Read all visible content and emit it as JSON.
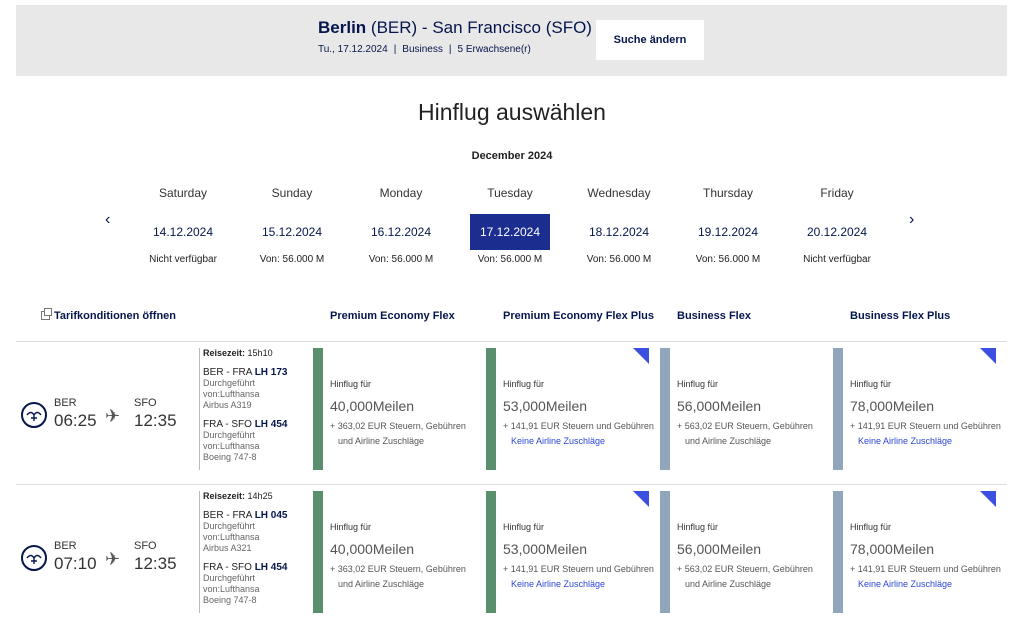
{
  "header": {
    "route_origin": "Berlin",
    "route_origin_code": "(BER)",
    "route_dash": " - ",
    "route_dest": "San Francisco (SFO)",
    "date": "Tu., 17.12.2024",
    "cabin": "Business",
    "passengers": "5 Erwachsene(r)",
    "separator": "|",
    "change_button": "Suche ändern"
  },
  "title": "Hinflug auswählen",
  "month": "December 2024",
  "nav": {
    "prev": "‹",
    "next": "›"
  },
  "days": [
    {
      "weekday": "Saturday",
      "date": "14.12.2024",
      "price": "Nicht verfügbar"
    },
    {
      "weekday": "Sunday",
      "date": "15.12.2024",
      "price": "Von: 56.000 M"
    },
    {
      "weekday": "Monday",
      "date": "16.12.2024",
      "price": "Von: 56.000 M"
    },
    {
      "weekday": "Tuesday",
      "date": "17.12.2024",
      "price": "Von: 56.000 M",
      "selected": true
    },
    {
      "weekday": "Wednesday",
      "date": "18.12.2024",
      "price": "Von: 56.000 M"
    },
    {
      "weekday": "Thursday",
      "date": "19.12.2024",
      "price": "Von: 56.000 M"
    },
    {
      "weekday": "Friday",
      "date": "20.12.2024",
      "price": "Nicht verfügbar"
    }
  ],
  "fare_header": {
    "open_conditions": "Tarifkonditionen öffnen",
    "columns": [
      "Premium Economy Flex",
      "Premium Economy Flex Plus",
      "Business Flex",
      "Business Flex Plus"
    ]
  },
  "flights": [
    {
      "dep_code": "BER",
      "dep_time": "06:25",
      "arr_code": "SFO",
      "arr_time": "12:35",
      "duration_label": "Reisezeit:",
      "duration": "15h10",
      "segments": [
        {
          "route": "BER - FRA",
          "flight": "LH 173",
          "op1": "Durchgeführt",
          "op2": "von:Lufthansa",
          "aircraft": "Airbus A319"
        },
        {
          "route": "FRA - SFO",
          "flight": "LH 454",
          "op1": "Durchgeführt",
          "op2": "von:Lufthansa",
          "aircraft": "Boeing 747-8"
        }
      ],
      "fares": [
        {
          "label": "Hinflug für",
          "miles": "40,000Meilen",
          "tax": "+ 363,02 EUR Steuern, Gebühren",
          "tax2": "und Airline Zuschläge",
          "link": "",
          "corner": false
        },
        {
          "label": "Hinflug für",
          "miles": "53,000Meilen",
          "tax": "+ 141,91 EUR Steuern und Gebühren",
          "tax2": "",
          "link": "Keine Airline Zuschläge",
          "corner": true
        },
        {
          "label": "Hinflug für",
          "miles": "56,000Meilen",
          "tax": "+ 563,02 EUR Steuern, Gebühren",
          "tax2": "und Airline Zuschläge",
          "link": "",
          "corner": false
        },
        {
          "label": "Hinflug für",
          "miles": "78,000Meilen",
          "tax": "+ 141,91 EUR Steuern und Gebühren",
          "tax2": "",
          "link": "Keine Airline Zuschläge",
          "corner": true
        }
      ]
    },
    {
      "dep_code": "BER",
      "dep_time": "07:10",
      "arr_code": "SFO",
      "arr_time": "12:35",
      "duration_label": "Reisezeit:",
      "duration": "14h25",
      "segments": [
        {
          "route": "BER - FRA",
          "flight": "LH 045",
          "op1": "Durchgeführt",
          "op2": "von:Lufthansa",
          "aircraft": "Airbus A321"
        },
        {
          "route": "FRA - SFO",
          "flight": "LH 454",
          "op1": "Durchgeführt",
          "op2": "von:Lufthansa",
          "aircraft": "Boeing 747-8"
        }
      ],
      "fares": [
        {
          "label": "Hinflug für",
          "miles": "40,000Meilen",
          "tax": "+ 363,02 EUR Steuern, Gebühren",
          "tax2": "und Airline Zuschläge",
          "link": "",
          "corner": false
        },
        {
          "label": "Hinflug für",
          "miles": "53,000Meilen",
          "tax": "+ 141,91 EUR Steuern und Gebühren",
          "tax2": "",
          "link": "Keine Airline Zuschläge",
          "corner": true
        },
        {
          "label": "Hinflug für",
          "miles": "56,000Meilen",
          "tax": "+ 563,02 EUR Steuern, Gebühren",
          "tax2": "und Airline Zuschläge",
          "link": "",
          "corner": false
        },
        {
          "label": "Hinflug für",
          "miles": "78,000Meilen",
          "tax": "+ 141,91 EUR Steuern und Gebühren",
          "tax2": "",
          "link": "Keine Airline Zuschläge",
          "corner": true
        }
      ]
    }
  ],
  "icons": {
    "airline_logo": "crane-logo-icon",
    "plane": "plane-icon",
    "corner": "corner-flag-icon",
    "open": "external-window-icon"
  },
  "colors": {
    "navy": "#05164d",
    "selected_date": "#1b2d8f",
    "premium_bar": "#5a8f6e",
    "business_bar": "#8fa6bb",
    "link": "#2c47d6",
    "corner": "#3b4fe0"
  }
}
